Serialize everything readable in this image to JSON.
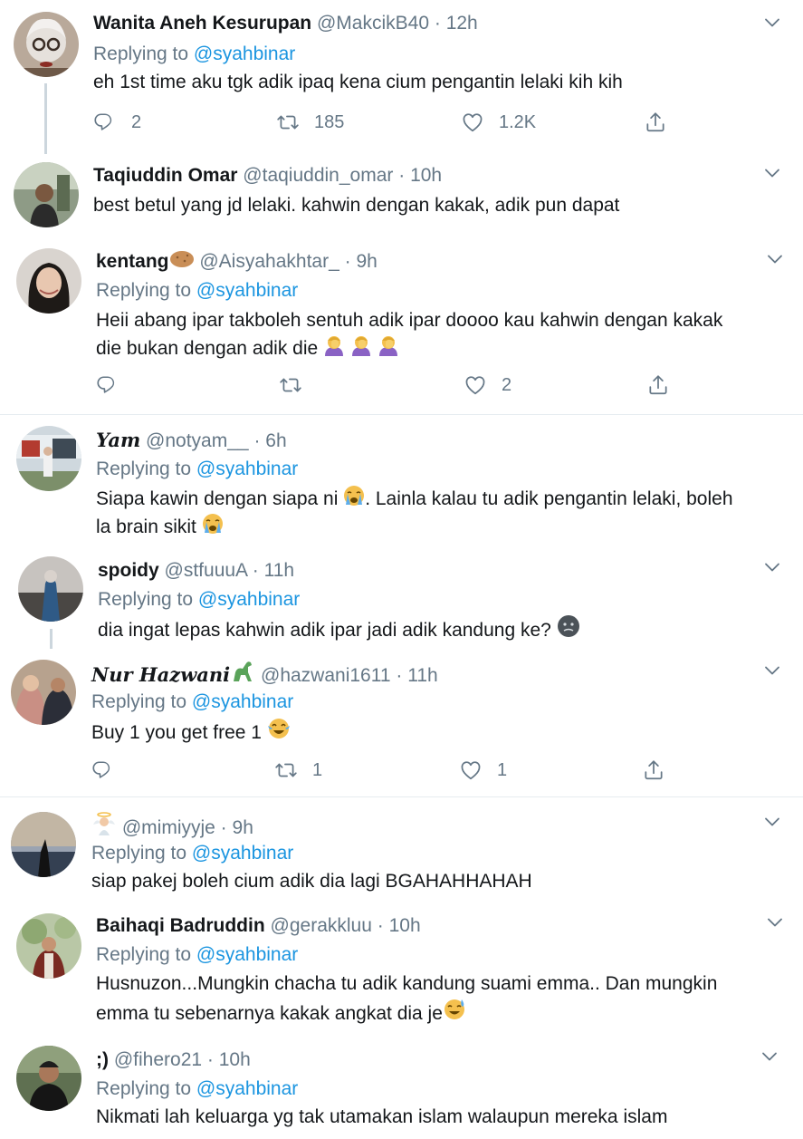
{
  "replies": [
    {
      "name": "Wanita Aneh Kesurupan",
      "handle": "@MakcikB40",
      "time": "12h",
      "replying_label": "Replying to",
      "replying_to": "@syahbinar",
      "text": "eh 1st time aku tgk adik ipaq kena cium pengantin lelaki kih kih",
      "counts": {
        "reply": "2",
        "retweet": "185",
        "like": "1.2K"
      }
    },
    {
      "name": "Taqiuddin Omar",
      "handle": "@taqiuddin_omar",
      "time": "10h",
      "text": "best betul yang jd lelaki. kahwin dengan kakak, adik pun dapat"
    },
    {
      "name": "kentang",
      "handle": "@Aisyahakhtar_",
      "time": "9h",
      "replying_label": "Replying to",
      "replying_to": "@syahbinar",
      "text_line1": "Heii abang ipar takboleh sentuh adik ipar doooo kau kahwin dengan kakak",
      "text_line2": "die bukan dengan adik die",
      "counts": {
        "reply": "",
        "retweet": "",
        "like": "2"
      }
    },
    {
      "name": "Yam",
      "handle": "@notyam__",
      "time": "6h",
      "replying_label": "Replying to",
      "replying_to": "@syahbinar",
      "text_line1a": "Siapa kawin dengan siapa ni ",
      "text_line1b": ". Lainla kalau tu adik pengantin lelaki, boleh",
      "text_line2": "la brain sikit "
    },
    {
      "name": "spoidy",
      "handle": "@stfuuuA",
      "time": "11h",
      "replying_label": "Replying to",
      "replying_to": "@syahbinar",
      "text": "dia ingat lepas kahwin adik ipar jadi adik kandung ke? "
    },
    {
      "name": "Nur Hazwani",
      "handle": "@hazwani1611",
      "time": "11h",
      "replying_label": "Replying to",
      "replying_to": "@syahbinar",
      "text": "Buy 1 you get free 1 ",
      "counts": {
        "reply": "",
        "retweet": "1",
        "like": "1"
      }
    },
    {
      "name": "",
      "handle": "@mimiyyje",
      "time": "9h",
      "replying_label": "Replying to",
      "replying_to": "@syahbinar",
      "text": "siap pakej boleh cium adik dia lagi BGAHAHHAHAH"
    },
    {
      "name": "Baihaqi Badruddin",
      "handle": "@gerakkluu",
      "time": "10h",
      "replying_label": "Replying to",
      "replying_to": "@syahbinar",
      "text_line1": "Husnuzon...Mungkin chacha tu adik kandung suami emma.. Dan mungkin",
      "text_line2": "emma tu sebenarnya kakak angkat dia je"
    },
    {
      "name": ";)",
      "handle": "@fihero21",
      "time": "10h",
      "replying_label": "Replying to",
      "replying_to": "@syahbinar",
      "text": "Nikmati lah keluarga yg tak utamakan islam walaupun mereka islam"
    }
  ],
  "separator": "·",
  "icons": [
    "reply-icon",
    "retweet-icon",
    "like-icon",
    "share-icon",
    "chevron-down-icon",
    "potato-emoji",
    "facepalm-emoji",
    "crying-emoji",
    "frowning-emoji",
    "dinosaur-emoji",
    "tears-of-joy-emoji",
    "angel-emoji",
    "sweat-smile-emoji"
  ],
  "colors": {
    "text": "#14171a",
    "secondary": "#657786",
    "link": "#1b95e0",
    "divider": "#e6ecf0",
    "thread_line": "#ccd6dd"
  }
}
